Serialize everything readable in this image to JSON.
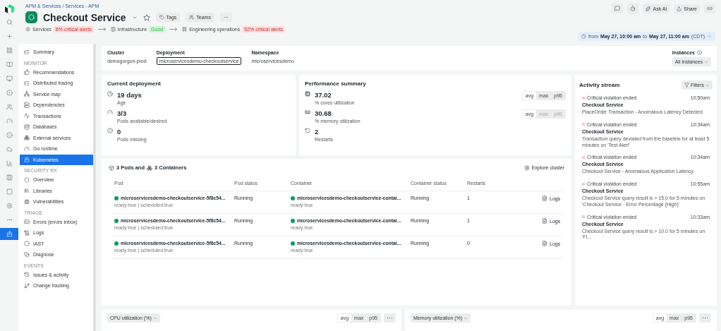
{
  "rail": [
    {
      "selected": false
    },
    {
      "selected": false
    },
    {
      "selected": false
    },
    {
      "selected": false
    },
    {
      "selected": false
    },
    {
      "selected": false
    },
    {
      "selected": false
    },
    {
      "selected": false
    },
    {
      "selected": false
    },
    {
      "selected": false
    },
    {
      "selected": false
    },
    {
      "selected": false
    },
    {
      "selected": false
    },
    {
      "selected": false
    },
    {
      "selected": false
    },
    {
      "selected": true
    }
  ],
  "breadcrumb": "APM & Services / Services - APM",
  "title": "Checkout Service",
  "title_buttons": [
    "Tags",
    "Teams",
    "···"
  ],
  "status_strip": [
    {
      "label": "Services",
      "badge": "8% critical alerts",
      "color": "#fcdede"
    },
    {
      "label": "Infrastructure",
      "badge": "Good",
      "color": "#d3f2dc"
    },
    {
      "label": "Engineering operations",
      "badge": "52% critical alerts",
      "color": "#fcdede"
    }
  ],
  "toolbar": {
    "ask": "Ask AI",
    "share": "Share"
  },
  "time_range": {
    "from_word": "from",
    "from": "May 27, 10:00 am",
    "to_word": "to",
    "to": "May 27, 11:00 am",
    "zone": "(CDT)"
  },
  "sidebar": [
    {
      "items": [
        {
          "label": "Summary",
          "selected": false
        }
      ]
    },
    {
      "heading": "MONITOR",
      "items": [
        {
          "label": "Recommendations",
          "selected": false
        },
        {
          "label": "Distributed tracing",
          "selected": false
        },
        {
          "label": "Service map",
          "selected": false
        },
        {
          "label": "Dependencies",
          "selected": false
        },
        {
          "label": "Transactions",
          "selected": false
        },
        {
          "label": "Databases",
          "selected": false
        },
        {
          "label": "External services",
          "selected": false
        },
        {
          "label": "Go runtime",
          "selected": false
        },
        {
          "label": "Kubernetes",
          "selected": true
        }
      ]
    },
    {
      "heading": "SECURITY RX",
      "items": [
        {
          "label": "Overview",
          "selected": false
        },
        {
          "label": "Libraries",
          "selected": false
        },
        {
          "label": "Vulnerabilities",
          "selected": false
        }
      ]
    },
    {
      "heading": "TRIAGE",
      "items": [
        {
          "label": "Errors (errors inbox)",
          "selected": false
        },
        {
          "label": "Logs",
          "selected": false
        },
        {
          "label": "IAST",
          "selected": false
        },
        {
          "label": "Diagnose",
          "selected": false
        }
      ]
    },
    {
      "heading": "EVENTS",
      "items": [
        {
          "label": "Issues & activity",
          "selected": false
        },
        {
          "label": "Change tracking",
          "selected": false
        }
      ]
    }
  ],
  "filters": [
    {
      "label": "Cluster",
      "value": "demogorgon-prod",
      "boxed": false
    },
    {
      "label": "Deployment",
      "value": "microservicesdemo-checkoutservice",
      "boxed": true
    },
    {
      "label": "Namespace",
      "value": "microservicesdemo",
      "boxed": false
    }
  ],
  "instances": {
    "label": "Instances",
    "value": "All instances"
  },
  "current_deployment": {
    "title": "Current deployment",
    "stats": [
      {
        "value": "19 days",
        "label": "Age"
      },
      {
        "value": "3/3",
        "label": "Pods available/desired"
      },
      {
        "value": "0",
        "label": "Pods missing"
      }
    ]
  },
  "performance_summary": {
    "title": "Performance summary",
    "stats": [
      {
        "value": "37.02",
        "label": "% cores utilization",
        "options": [
          {
            "label": "avg",
            "selected": true,
            "disabled": false
          },
          {
            "label": "max",
            "selected": false,
            "disabled": false
          },
          {
            "label": "p95",
            "selected": false,
            "disabled": false
          }
        ]
      },
      {
        "value": "30.68",
        "label": "% memory utilization",
        "options": [
          {
            "label": "avg",
            "selected": true,
            "disabled": false
          },
          {
            "label": "max",
            "selected": false,
            "disabled": true
          },
          {
            "label": "p95",
            "selected": false,
            "disabled": true
          }
        ]
      },
      {
        "value": "2",
        "label": "Restarts"
      }
    ]
  },
  "pods": {
    "pods_count": "3 Pods and",
    "containers_count": "3 Containers",
    "explore": "Explore cluster",
    "columns": [
      "Pod",
      "Pod status",
      "Container",
      "Container status",
      "Restarts"
    ],
    "rows": [
      {
        "pod": "microservicesdemo-checkoutservice-5f8c54...",
        "pod_meta": "ready:true | scheduled:true",
        "pod_status": "Running",
        "container": "microservicesdemo-checkoutservice-contai...",
        "container_meta": "ready:true",
        "container_status": "Running",
        "restarts": "1",
        "action": "Logs"
      },
      {
        "pod": "microservicesdemo-checkoutservice-5f8c54...",
        "pod_meta": "ready:true | scheduled:true",
        "pod_status": "Running",
        "container": "microservicesdemo-checkoutservice-contai...",
        "container_meta": "ready:true",
        "container_status": "Running",
        "restarts": "1",
        "action": "Logs"
      },
      {
        "pod": "microservicesdemo-checkoutservice-5f8c54...",
        "pod_meta": "ready:true | scheduled:true",
        "pod_status": "Running",
        "container": "microservicesdemo-checkoutservice-contai...",
        "container_meta": "ready:true",
        "container_status": "Running",
        "restarts": "0",
        "action": "Logs"
      }
    ]
  },
  "activity": {
    "title": "Activity stream",
    "filters": "Filters",
    "items": [
      {
        "event": "Critical violation ended",
        "time": "10:50am",
        "service": "Checkout Service",
        "text": "PlaceOrder Transaction - Anomalous Latency Detected"
      },
      {
        "event": "Critical violation ended",
        "time": "10:34am",
        "service": "Checkout Service",
        "text": "Transaction query deviated from the baseline for at least 5 minutes on 'Test Alert'"
      },
      {
        "event": "Critical violation ended",
        "time": "10:34am",
        "service": "Checkout Service",
        "text": "Checkout Service - Anomalous Application Latency"
      },
      {
        "event": "Critical violation ended",
        "time": "10:55am",
        "service": "Checkout Service",
        "text": "Checkout Service query result is > 15.0 for 5 minutes on 'Checkout Service - Error Percentage (High)'"
      },
      {
        "event": "Critical violation ended",
        "time": "10:33am",
        "service": "Checkout Service",
        "text": "Checkout Service query result is > 10.0 for 5 minutes on 'Fl..."
      }
    ]
  },
  "charts": [
    {
      "title": "CPU utilization (%)",
      "options": [
        {
          "label": "avg",
          "selected": true
        },
        {
          "label": "max",
          "selected": false
        },
        {
          "label": "p95",
          "selected": false
        }
      ],
      "more": "···"
    },
    {
      "title": "Memory utilization (%)",
      "options": [
        {
          "label": "avg",
          "selected": true
        },
        {
          "label": "max",
          "selected": false
        },
        {
          "label": "p95",
          "selected": false
        }
      ],
      "more": "···"
    }
  ]
}
